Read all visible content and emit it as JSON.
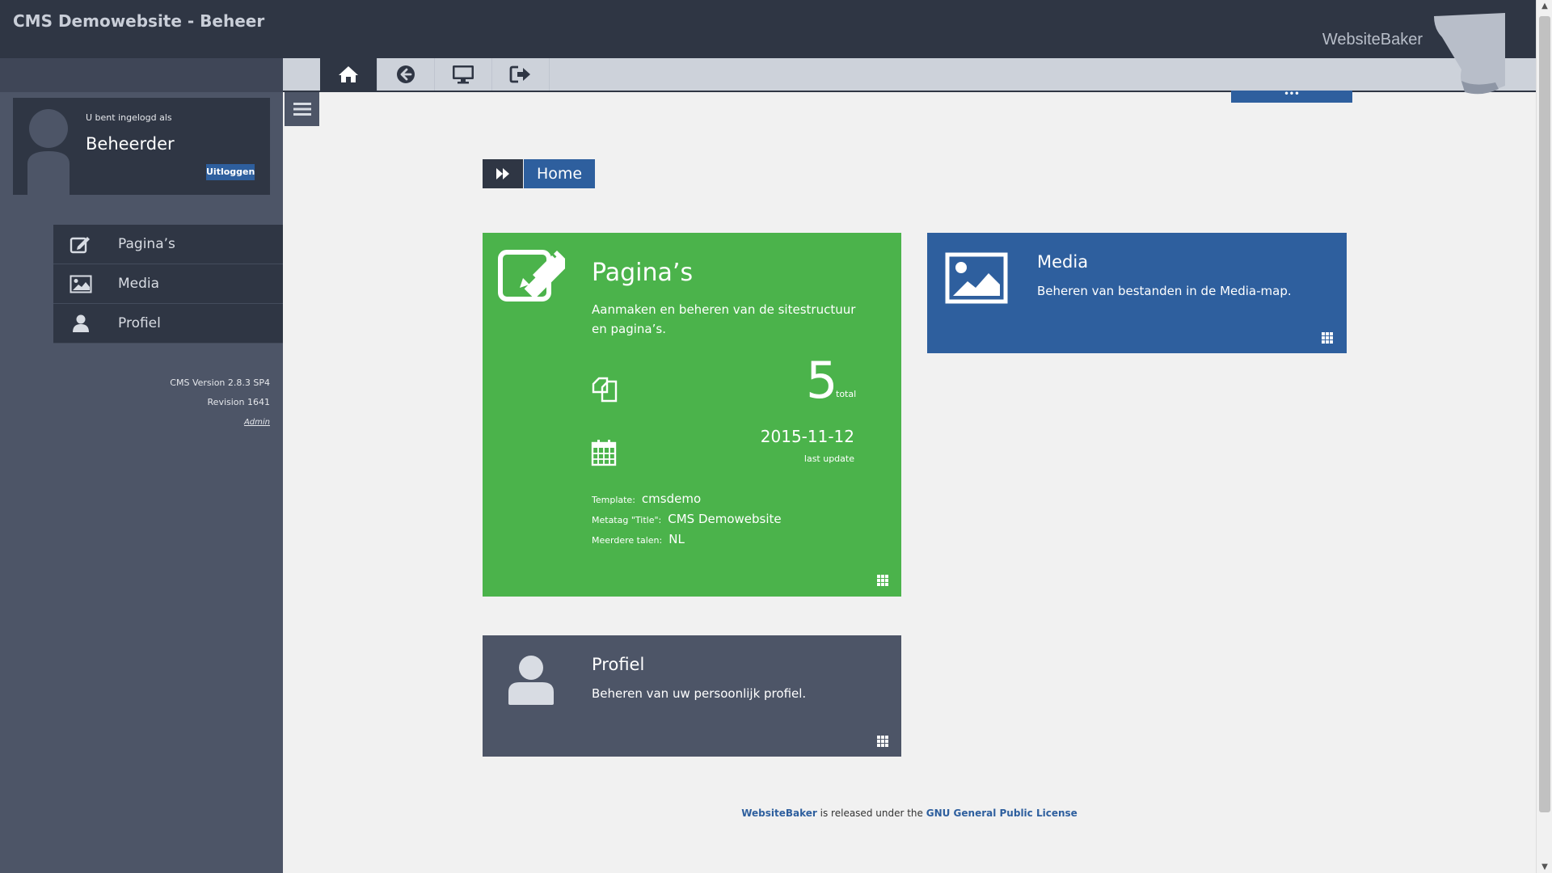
{
  "header": {
    "site_title": "CMS Demowebsite - Beheer",
    "brand": "WebsiteBaker"
  },
  "user": {
    "logged_in_label": "U bent ingelogd als",
    "username": "Beheerder",
    "logout_label": "Uitloggen"
  },
  "nav": {
    "items": [
      {
        "label": "Pagina’s",
        "icon": "edit-icon"
      },
      {
        "label": "Media",
        "icon": "image-icon"
      },
      {
        "label": "Profiel",
        "icon": "user-icon"
      }
    ]
  },
  "version": {
    "cms_version": "CMS Version 2.8.3 SP4",
    "revision": "Revision 1641",
    "admin": "Admin"
  },
  "toolbar": {
    "buttons": [
      "home-icon",
      "back-icon",
      "desktop-icon",
      "sign-out-icon"
    ],
    "more_label": "•••"
  },
  "breadcrumb": {
    "label": "Home"
  },
  "cards": {
    "pages": {
      "title": "Pagina’s",
      "description": "Aanmaken en beheren van de sitestructuur en pagina’s.",
      "total": "5",
      "total_label": "total",
      "last_update": "2015-11-12",
      "last_update_label": "last update",
      "template_label": "Template:",
      "template_value": "cmsdemo",
      "metatag_label": "Metatag \"Title\":",
      "metatag_value": "CMS Demowebsite",
      "languages_label": "Meerdere talen:",
      "languages_value": "NL"
    },
    "media": {
      "title": "Media",
      "description": "Beheren van bestanden in de Media-map."
    },
    "profile": {
      "title": "Profiel",
      "description": "Beheren van uw persoonlijk profiel."
    }
  },
  "footer": {
    "brand": "WebsiteBaker",
    "middle": " is released under the ",
    "license": "GNU General Public License"
  },
  "colors": {
    "header": "#2f3644",
    "sidebar": "#4d5567",
    "accent_blue": "#2e5f9e",
    "pages_green": "#4bb34b",
    "background": "#f1f1f1"
  }
}
